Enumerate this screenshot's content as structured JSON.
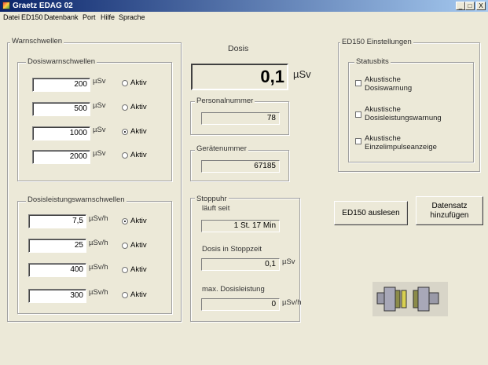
{
  "window": {
    "title": "Graetz EDAG 02",
    "minimize": "_",
    "restore": "□",
    "close": "X"
  },
  "menu": [
    "Datei",
    "ED150",
    "Datenbank",
    "Port",
    "Hilfe",
    "Sprache"
  ],
  "warnschwellen": {
    "label": "Warnschwellen",
    "dosis_group": {
      "label": "Dosiswarnschwellen",
      "rows": [
        {
          "value": "200",
          "unit": "µSv",
          "radio": "Aktiv",
          "selected": false
        },
        {
          "value": "500",
          "unit": "µSv",
          "radio": "Aktiv",
          "selected": false
        },
        {
          "value": "1000",
          "unit": "µSv",
          "radio": "Aktiv",
          "selected": true
        },
        {
          "value": "2000",
          "unit": "µSv",
          "radio": "Aktiv",
          "selected": false
        }
      ]
    },
    "leistung_group": {
      "label": "Dosisleistungswarnschwellen",
      "rows": [
        {
          "value": "7,5",
          "unit": "µSv/h",
          "radio": "Aktiv",
          "selected": true
        },
        {
          "value": "25",
          "unit": "µSv/h",
          "radio": "Aktiv",
          "selected": false
        },
        {
          "value": "400",
          "unit": "µSv/h",
          "radio": "Aktiv",
          "selected": false
        },
        {
          "value": "300",
          "unit": "µSv/h",
          "radio": "Aktiv",
          "selected": false
        }
      ]
    }
  },
  "dosis": {
    "label": "Dosis",
    "value": "0,1",
    "unit": "µSv"
  },
  "personalnummer": {
    "label": "Personalnummer",
    "value": "78"
  },
  "geraetenummer": {
    "label": "Gerätenummer",
    "value": "67185"
  },
  "stoppuhr": {
    "label": "Stoppuhr",
    "laeuft_seit_label": "läuft seit",
    "laeuft_seit_value": "1 St. 17 Min",
    "dosis_label": "Dosis in Stoppzeit",
    "dosis_value": "0,1",
    "dosis_unit": "µSv",
    "max_label": "max. Dosisleistung",
    "max_value": "0",
    "max_unit": "µSv/h"
  },
  "ed150": {
    "label": "ED150 Einstellungen",
    "statusbits_label": "Statusbits",
    "checkboxes": [
      {
        "line1": "Akustische",
        "line2": "Dosiswarnung",
        "checked": false
      },
      {
        "line1": "Akustische",
        "line2": "Dosisleistungswarnung",
        "checked": false
      },
      {
        "line1": "Akustische",
        "line2": "Einzelimpulseanzeige",
        "checked": false
      }
    ]
  },
  "buttons": {
    "auslesen": "ED150 auslesen",
    "datensatz_line1": "Datensatz",
    "datensatz_line2": "hinzufügen"
  },
  "colors": {
    "titlebar_start": "#0a246a",
    "titlebar_end": "#a6caf0",
    "background": "#ece9d8"
  },
  "icons": {
    "app": "app-icon",
    "device": "device-dock-icon"
  }
}
